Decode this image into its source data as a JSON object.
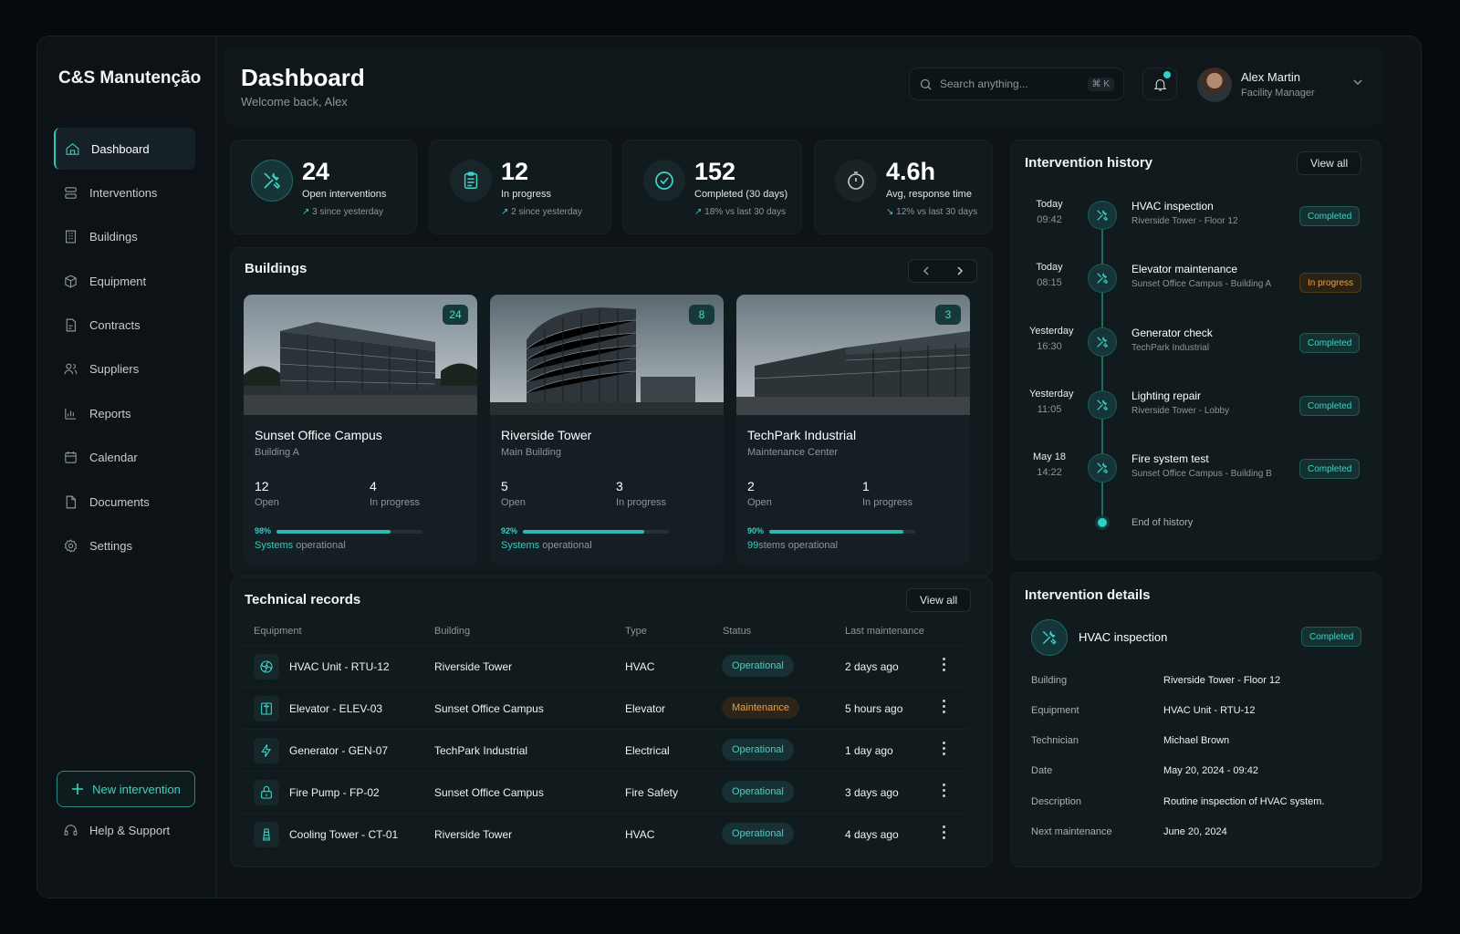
{
  "app": {
    "brand": "C&S Manutenção"
  },
  "sidebar": {
    "items": [
      {
        "label": "Dashboard",
        "icon": "home-icon"
      },
      {
        "label": "Interventions",
        "icon": "wrench-icon"
      },
      {
        "label": "Buildings",
        "icon": "building-icon"
      },
      {
        "label": "Equipment",
        "icon": "cube-icon"
      },
      {
        "label": "Contracts",
        "icon": "file-icon"
      },
      {
        "label": "Suppliers",
        "icon": "users-icon"
      },
      {
        "label": "Reports",
        "icon": "chart-icon"
      },
      {
        "label": "Calendar",
        "icon": "calendar-icon"
      },
      {
        "label": "Documents",
        "icon": "document-icon"
      },
      {
        "label": "Settings",
        "icon": "gear-icon"
      }
    ],
    "new_button": "New intervention",
    "help": "Help & Support"
  },
  "header": {
    "title": "Dashboard",
    "subtitle": "Welcome back, Alex",
    "search_placeholder": "Search anything...",
    "search_shortcut": "⌘ K",
    "user_name": "Alex Martin",
    "user_role": "Facility Manager"
  },
  "stats": [
    {
      "value": "24",
      "label": "Open interventions",
      "delta": "3 since yesterday"
    },
    {
      "value": "12",
      "label": "In progress",
      "delta": "2 since yesterday"
    },
    {
      "value": "152",
      "label": "Completed (30 days)",
      "delta": "18% vs last 30 days"
    },
    {
      "value": "4.6h",
      "label": "Avg, response time",
      "delta": "12% vs last 30 days"
    }
  ],
  "buildings": {
    "title": "Buildings",
    "cards": [
      {
        "name": "Sunset Office Campus",
        "sub": "Building A",
        "badge": "24",
        "open": "12",
        "open_label": "Open",
        "progress": "4",
        "progress_label": "In progress",
        "pct_text": "98%",
        "operational": 0.78,
        "footer_accent": "Systems",
        "footer_rest": " operational"
      },
      {
        "name": "Riverside Tower",
        "sub": "Main Building",
        "badge": "8",
        "open": "5",
        "open_label": "Open",
        "progress": "3",
        "progress_label": "In progress",
        "pct_text": "92%",
        "operational": 0.83,
        "footer_accent": "Systems",
        "footer_rest": " operational"
      },
      {
        "name": "TechPark Industrial",
        "sub": "Maintenance Center",
        "badge": "3",
        "open": "2",
        "open_label": "Open",
        "progress": "1",
        "progress_label": "In progress",
        "pct_text": "90%",
        "operational": 0.92,
        "footer_accent": "99",
        "footer_rest": "stems operational"
      }
    ]
  },
  "records": {
    "title": "Technical records",
    "view_all": "View all",
    "columns": [
      "Equipment",
      "Building",
      "Type",
      "Status",
      "Last maintenance"
    ],
    "rows": [
      {
        "equipment": "HVAC Unit - RTU-12",
        "building": "Riverside Tower",
        "type": "HVAC",
        "status": "Operational",
        "status_kind": "ok",
        "last": "2 days ago",
        "icon": "fan-icon"
      },
      {
        "equipment": "Elevator - ELEV-03",
        "building": "Sunset Office Campus",
        "type": "Elevator",
        "status": "Maintenance",
        "status_kind": "warn",
        "last": "5 hours ago",
        "icon": "elevator-icon"
      },
      {
        "equipment": "Generator - GEN-07",
        "building": "TechPark Industrial",
        "type": "Electrical",
        "status": "Operational",
        "status_kind": "ok",
        "last": "1 day ago",
        "icon": "bolt-icon"
      },
      {
        "equipment": "Fire Pump - FP-02",
        "building": "Sunset Office Campus",
        "type": "Fire Safety",
        "status": "Operational",
        "status_kind": "ok",
        "last": "3 days ago",
        "icon": "fire-pump-icon"
      },
      {
        "equipment": "Cooling Tower - CT-01",
        "building": "Riverside Tower",
        "type": "HVAC",
        "status": "Operational",
        "status_kind": "ok",
        "last": "4 days ago",
        "icon": "cooling-tower-icon"
      }
    ]
  },
  "history": {
    "title": "Intervention history",
    "view_all": "View all",
    "items": [
      {
        "day": "Today",
        "time": "09:42",
        "title": "HVAC inspection",
        "sub": "Riverside Tower - Floor 12",
        "status": "Completed",
        "kind": "ok"
      },
      {
        "day": "Today",
        "time": "08:15",
        "title": "Elevator maintenance",
        "sub": "Sunset Office Campus - Building A",
        "status": "In progress",
        "kind": "warn"
      },
      {
        "day": "Yesterday",
        "time": "16:30",
        "title": "Generator check",
        "sub": "TechPark Industrial",
        "status": "Completed",
        "kind": "ok"
      },
      {
        "day": "Yesterday",
        "time": "11:05",
        "title": "Lighting repair",
        "sub": "Riverside Tower - Lobby",
        "status": "Completed",
        "kind": "ok"
      },
      {
        "day": "May 18",
        "time": "14:22",
        "title": "Fire system test",
        "sub": "Sunset Office Campus - Building B",
        "status": "Completed",
        "kind": "ok"
      }
    ],
    "end": "End of history"
  },
  "details": {
    "title": "Intervention details",
    "name": "HVAC inspection",
    "status": "Completed",
    "rows": [
      {
        "label": "Building",
        "value": "Riverside Tower - Floor 12"
      },
      {
        "label": "Equipment",
        "value": "HVAC Unit - RTU-12"
      },
      {
        "label": "Technician",
        "value": "Michael Brown"
      },
      {
        "label": "Date",
        "value": "May 20, 2024 - 09:42"
      },
      {
        "label": "Description",
        "value": "Routine inspection of HVAC system."
      },
      {
        "label": "Next maintenance",
        "value": "June 20, 2024"
      }
    ]
  },
  "colors": {
    "accent": "#2fd0c6",
    "warning": "#e4a050",
    "background": "#0d1316"
  }
}
